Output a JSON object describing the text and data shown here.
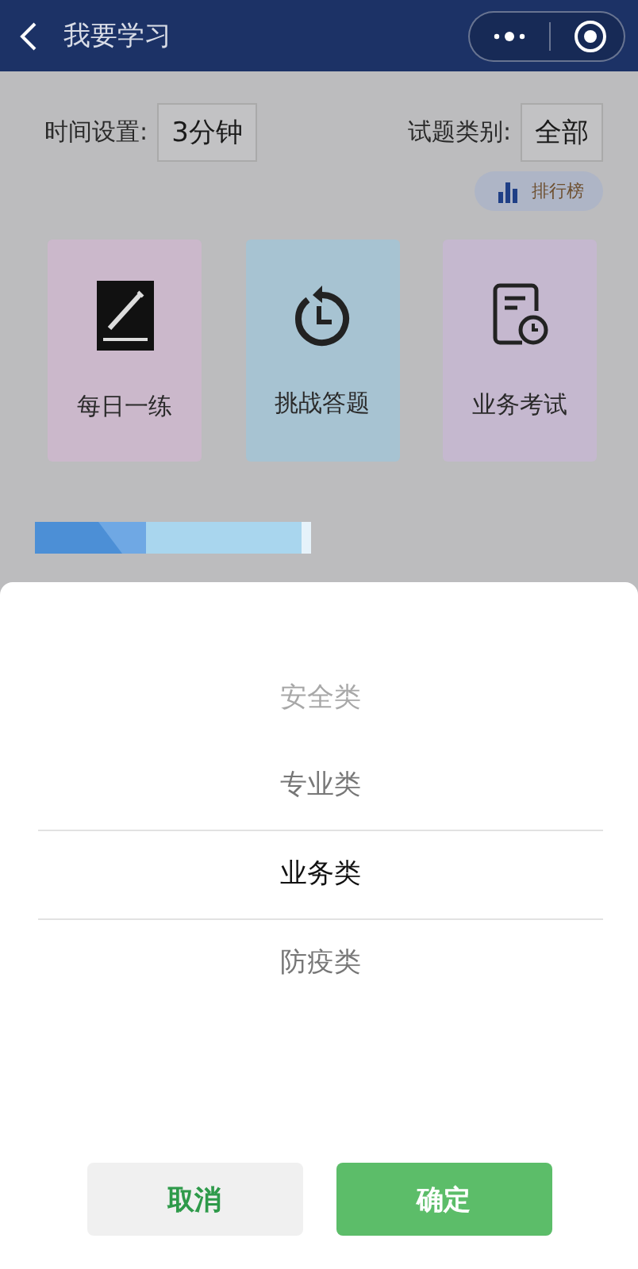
{
  "header": {
    "title": "我要学习"
  },
  "settings": {
    "time_label": "时间设置:",
    "time_value": "3分钟",
    "category_label": "试题类别:",
    "category_value": "全部",
    "ranking_button": "排行榜"
  },
  "tiles": [
    {
      "label": "每日一练",
      "kind": "pencil",
      "color": "#cbb8cb"
    },
    {
      "label": "挑战答题",
      "kind": "timer",
      "color": "#a7c3d2"
    },
    {
      "label": "业务考试",
      "kind": "exam",
      "color": "#c5b8cf"
    }
  ],
  "picker": {
    "options": [
      {
        "label": "安全类",
        "selected": false
      },
      {
        "label": "专业类",
        "selected": false
      },
      {
        "label": "业务类",
        "selected": true
      },
      {
        "label": "防疫类",
        "selected": false
      }
    ],
    "buttons": [
      {
        "label": "取消",
        "kind": "cancel"
      },
      {
        "label": "确定",
        "kind": "confirm"
      }
    ]
  }
}
